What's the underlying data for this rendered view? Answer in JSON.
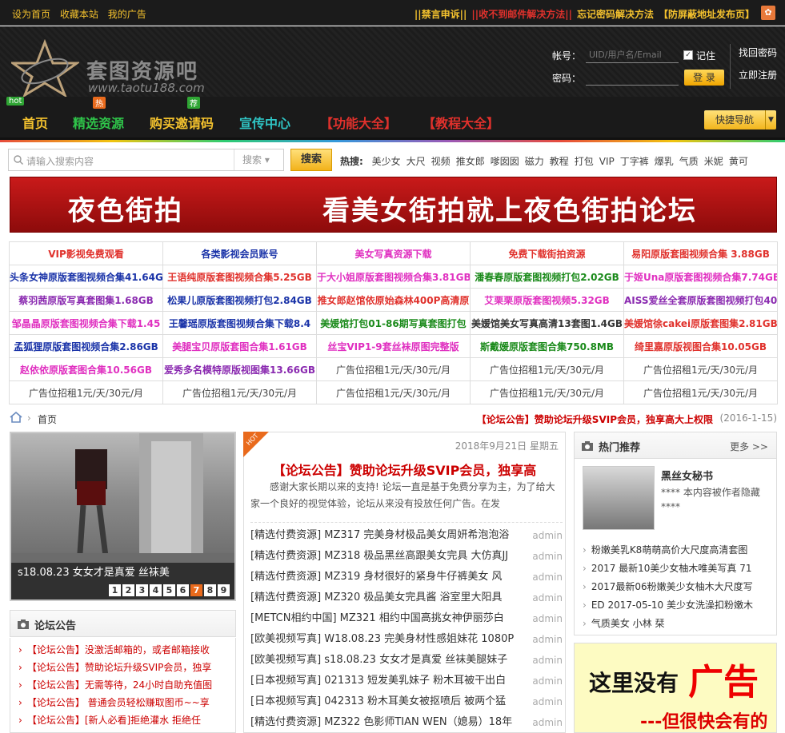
{
  "topbar": {
    "left": [
      "设为首页",
      "收藏本站",
      "我的广告"
    ],
    "right": [
      {
        "text": "||禁言申诉||",
        "color": "#f4c22e"
      },
      {
        "text": "||收不到邮件解决方法||",
        "color": "#e0312c"
      },
      {
        "text": "忘记密码解决方法",
        "color": "#f4c22e"
      },
      {
        "text": "【防屏蔽地址发布页】",
        "color": "#f4c22e"
      }
    ]
  },
  "header": {
    "logo_text": "套图资源吧",
    "logo_url": "www.taotu188.com",
    "account_label": "帐号：",
    "account_placeholder": "UID/用户名/Email",
    "remember_label": "记住",
    "password_label": "密码：",
    "login_button": "登 录",
    "find_password": "找回密码",
    "register": "立即注册"
  },
  "nav": {
    "items": [
      {
        "label": "首页",
        "color": "#f4c22e",
        "tag": "hot",
        "tag_color": "#2fa534"
      },
      {
        "label": "精选资源",
        "color": "#2fc44a",
        "tag": "热",
        "tag_color": "#e96a1c"
      },
      {
        "label": "购买邀请码",
        "color": "#f4c22e",
        "tag": "荐",
        "tag_color": "#2fa534"
      },
      {
        "label": "宣传中心",
        "color": "#2fc4c4"
      },
      {
        "label": "【功能大全】",
        "color": "#e0312c"
      },
      {
        "label": "【教程大全】",
        "color": "#e0312c"
      }
    ],
    "quick_nav": "快捷导航"
  },
  "search": {
    "placeholder": "请输入搜索内容",
    "select": "搜索",
    "button": "搜索",
    "hot_label": "热搜:",
    "hot_words": [
      "美少女",
      "大尺",
      "视频",
      "推女郎",
      "嗲囡囡",
      "磁力",
      "教程",
      "打包",
      "VIP",
      "丁字裤",
      "爆乳",
      "气质",
      "米妮",
      "黄可"
    ]
  },
  "banner": {
    "left": "夜色街拍",
    "right": "看美女街拍就上夜色街拍论坛"
  },
  "link_table": [
    [
      {
        "t": "VIP影视免费观看",
        "c": "#e0312c"
      },
      {
        "t": "各类影视会员账号",
        "c": "#1a33a8"
      },
      {
        "t": "美女写真资源下载",
        "c": "#e030c0"
      },
      {
        "t": "免费下载街拍资源",
        "c": "#e0312c"
      },
      {
        "t": "易阳原版套图视频合集 3.88GB",
        "c": "#e0312c"
      }
    ],
    [
      {
        "t": "头条女神原版套图视频合集41.64G",
        "c": "#1a33a8"
      },
      {
        "t": "王语纯原版套图视频合集5.25GB",
        "c": "#e0312c"
      },
      {
        "t": "于大小姐原版套图视频合集3.81GB",
        "c": "#e030c0"
      },
      {
        "t": "潘春春原版套图视频打包2.02GB",
        "c": "#1a8a1a"
      },
      {
        "t": "于姬Una原版套图视频合集7.74GB",
        "c": "#e030c0"
      }
    ],
    [
      {
        "t": "蔡羽茜原版写真套图集1.68GB",
        "c": "#8a2ab0"
      },
      {
        "t": "松果儿原版套图视频打包2.84GB",
        "c": "#1a33a8"
      },
      {
        "t": "推女郎赵馆依原始森林400P高清原",
        "c": "#e0312c"
      },
      {
        "t": "艾栗栗原版套图视频5.32GB",
        "c": "#e030c0"
      },
      {
        "t": "AISS爱丝全套原版套图视频打包40",
        "c": "#8a2ab0"
      }
    ],
    [
      {
        "t": "邹晶晶原版套图视频合集下载1.45",
        "c": "#e030c0"
      },
      {
        "t": "王馨瑶原版套图视频合集下载8.4",
        "c": "#1a33a8"
      },
      {
        "t": "美媛馆打包01-86期写真套图打包",
        "c": "#1a8a1a"
      },
      {
        "t": "美媛馆美女写真高清13套图1.4GB",
        "c": "#333333"
      },
      {
        "t": "美媛馆徐cakei原版套图集2.81GB",
        "c": "#e0312c"
      }
    ],
    [
      {
        "t": "孟狐狸原版套图视频合集2.86GB",
        "c": "#1a33a8"
      },
      {
        "t": "美腿宝贝原版套图合集1.61GB",
        "c": "#e030c0"
      },
      {
        "t": "丝宝VIP1-9套丝袜原图完整版",
        "c": "#e030c0"
      },
      {
        "t": "斯戴媛原版套图合集750.8MB",
        "c": "#1a8a1a"
      },
      {
        "t": "绮里嘉原版视图合集10.05GB",
        "c": "#e0312c"
      }
    ],
    [
      {
        "t": "赵依依原版套图合集10.56GB",
        "c": "#e030c0"
      },
      {
        "t": "爱秀多名模特原版视图集13.66GB",
        "c": "#8a2ab0"
      },
      {
        "t": "广告位招租1元/天/30元/月",
        "c": "#444444",
        "g": true
      },
      {
        "t": "广告位招租1元/天/30元/月",
        "c": "#444444",
        "g": true
      },
      {
        "t": "广告位招租1元/天/30元/月",
        "c": "#444444",
        "g": true
      }
    ],
    [
      {
        "t": "广告位招租1元/天/30元/月",
        "c": "#444444",
        "g": true
      },
      {
        "t": "广告位招租1元/天/30元/月",
        "c": "#444444",
        "g": true
      },
      {
        "t": "广告位招租1元/天/30元/月",
        "c": "#444444",
        "g": true
      },
      {
        "t": "广告位招租1元/天/30元/月",
        "c": "#444444",
        "g": true
      },
      {
        "t": "广告位招租1元/天/30元/月",
        "c": "#444444",
        "g": true
      }
    ]
  ],
  "breadcrumb": {
    "sep": "›",
    "current": "首页",
    "notice": "【论坛公告】赞助论坛升级SVIP会员，独享高大上权限",
    "date": "(2016-1-15)"
  },
  "slideshow": {
    "caption": "s18.08.23 女女才是真爱 丝袜美",
    "pages": [
      "1",
      "2",
      "3",
      "4",
      "5",
      "6",
      "7",
      "8",
      "9"
    ],
    "active": 7
  },
  "forum_notice": {
    "title": "论坛公告",
    "items": [
      "【论坛公告】没激活邮箱的，或者邮箱接收",
      "【论坛公告】赞助论坛升级SVIP会员，独享",
      "【论坛公告】无需等待，24小时自助充值图",
      "【论坛公告】 普通会员轻松赚取图币~~享",
      "【论坛公告】[新人必看]拒绝灌水 拒绝任"
    ]
  },
  "center": {
    "date": "2018年9月21日 星期五",
    "title": "【论坛公告】赞助论坛升级SVIP会员，独享高",
    "desc": "感谢大家长期以来的支持! 论坛一直是基于免费分享为主，为了给大家一个良好的视觉体验，论坛从来没有投放任何广告。在发",
    "threads": [
      {
        "t": "[精选付费资源] MZ317 完美身材极品美女周妍希泡泡浴",
        "u": "admin"
      },
      {
        "t": "[精选付费资源] MZ318 极品黑丝高跟美女完具 大仿真JJ",
        "u": "admin"
      },
      {
        "t": "[精选付费资源] MZ319 身材很好的紧身牛仔裤美女 风",
        "u": "admin"
      },
      {
        "t": "[精选付费资源] MZ320 极品美女完具酱 浴室里大阳具",
        "u": "admin"
      },
      {
        "t": "[METCN相约中国] MZ321 相约中国高挑女神伊丽莎白",
        "u": "admin"
      },
      {
        "t": "[欧美视频写真] W18.08.23 完美身材性感姐妹花 1080P",
        "u": "admin"
      },
      {
        "t": "[欧美视频写真] s18.08.23 女女才是真爱 丝袜美腿妹子",
        "u": "admin"
      },
      {
        "t": "[日本视频写真] 021313 短发美乳妹子 粉木耳被干出白",
        "u": "admin"
      },
      {
        "t": "[日本视频写真] 042313 粉木耳美女被抠喷后 被两个猛",
        "u": "admin"
      },
      {
        "t": "[精选付费资源] MZ322 色影师TIAN WEN（媳易）18年",
        "u": "admin"
      }
    ]
  },
  "hot": {
    "title": "热门推荐",
    "more": "更多 >>",
    "feature_title": "黑丝女秘书",
    "feature_desc": "**** 本内容被作者隐藏 ****",
    "items": [
      "粉嫩美乳K8萌萌高价大尺度高清套图",
      "2017 最新10美少女柚木唯美写真 71",
      "2017最新06粉嫩美少女柚木大尺度写",
      "ED 2017-05-10 美少女洗澡扣粉嫩木",
      "气质美女 小林 栞"
    ]
  },
  "ad": {
    "line1": "这里没有",
    "line2": "广告",
    "line3": "---但很快会有的"
  }
}
